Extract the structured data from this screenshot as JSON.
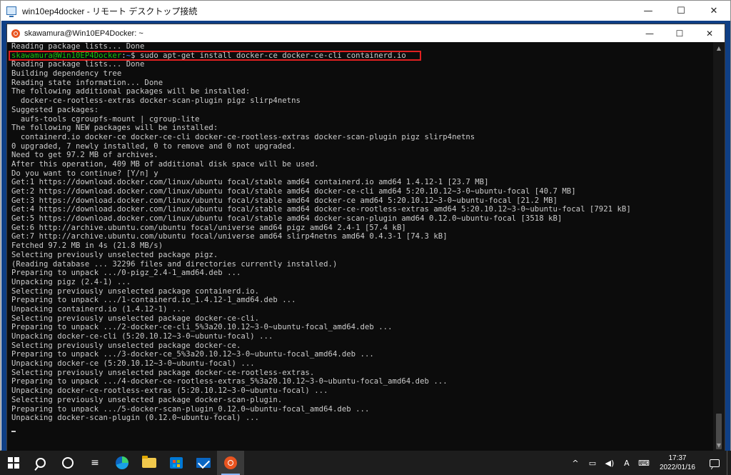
{
  "rdp": {
    "title": "win10ep4docker - リモート デスクトップ接続",
    "minimize": "—",
    "maximize": "☐",
    "close": "✕"
  },
  "terminal": {
    "title": "skawamura@Win10EP4Docker: ~",
    "minimize": "—",
    "maximize": "☐",
    "close": "✕",
    "prompt": {
      "user_host": "skawamura@Win10EP4Docker",
      "separator": ":",
      "path": "~",
      "symbol": "$",
      "command": "sudo apt-get install docker-ce docker-ce-cli containerd.io"
    },
    "lines_before": [
      "Reading package lists... Done"
    ],
    "lines_after": [
      "Reading package lists... Done",
      "Building dependency tree",
      "Reading state information... Done",
      "The following additional packages will be installed:",
      "  docker-ce-rootless-extras docker-scan-plugin pigz slirp4netns",
      "Suggested packages:",
      "  aufs-tools cgroupfs-mount | cgroup-lite",
      "The following NEW packages will be installed:",
      "  containerd.io docker-ce docker-ce-cli docker-ce-rootless-extras docker-scan-plugin pigz slirp4netns",
      "0 upgraded, 7 newly installed, 0 to remove and 0 not upgraded.",
      "Need to get 97.2 MB of archives.",
      "After this operation, 409 MB of additional disk space will be used.",
      "Do you want to continue? [Y/n] y",
      "Get:1 https://download.docker.com/linux/ubuntu focal/stable amd64 containerd.io amd64 1.4.12-1 [23.7 MB]",
      "Get:2 https://download.docker.com/linux/ubuntu focal/stable amd64 docker-ce-cli amd64 5:20.10.12~3-0~ubuntu-focal [40.7 MB]",
      "Get:3 https://download.docker.com/linux/ubuntu focal/stable amd64 docker-ce amd64 5:20.10.12~3-0~ubuntu-focal [21.2 MB]",
      "Get:4 https://download.docker.com/linux/ubuntu focal/stable amd64 docker-ce-rootless-extras amd64 5:20.10.12~3-0~ubuntu-focal [7921 kB]",
      "Get:5 https://download.docker.com/linux/ubuntu focal/stable amd64 docker-scan-plugin amd64 0.12.0~ubuntu-focal [3518 kB]",
      "Get:6 http://archive.ubuntu.com/ubuntu focal/universe amd64 pigz amd64 2.4-1 [57.4 kB]",
      "Get:7 http://archive.ubuntu.com/ubuntu focal/universe amd64 slirp4netns amd64 0.4.3-1 [74.3 kB]",
      "Fetched 97.2 MB in 4s (21.8 MB/s)",
      "Selecting previously unselected package pigz.",
      "(Reading database ... 32296 files and directories currently installed.)",
      "Preparing to unpack .../0-pigz_2.4-1_amd64.deb ...",
      "Unpacking pigz (2.4-1) ...",
      "Selecting previously unselected package containerd.io.",
      "Preparing to unpack .../1-containerd.io_1.4.12-1_amd64.deb ...",
      "Unpacking containerd.io (1.4.12-1) ...",
      "Selecting previously unselected package docker-ce-cli.",
      "Preparing to unpack .../2-docker-ce-cli_5%3a20.10.12~3-0~ubuntu-focal_amd64.deb ...",
      "Unpacking docker-ce-cli (5:20.10.12~3-0~ubuntu-focal) ...",
      "Selecting previously unselected package docker-ce.",
      "Preparing to unpack .../3-docker-ce_5%3a20.10.12~3-0~ubuntu-focal_amd64.deb ...",
      "Unpacking docker-ce (5:20.10.12~3-0~ubuntu-focal) ...",
      "Selecting previously unselected package docker-ce-rootless-extras.",
      "Preparing to unpack .../4-docker-ce-rootless-extras_5%3a20.10.12~3-0~ubuntu-focal_amd64.deb ...",
      "Unpacking docker-ce-rootless-extras (5:20.10.12~3-0~ubuntu-focal) ...",
      "Selecting previously unselected package docker-scan-plugin.",
      "Preparing to unpack .../5-docker-scan-plugin_0.12.0~ubuntu-focal_amd64.deb ...",
      "Unpacking docker-scan-plugin (0.12.0~ubuntu-focal) ..."
    ],
    "highlight_color": "#e02020"
  },
  "taskbar": {
    "items": [
      {
        "name": "start-button",
        "icon": "windows-logo-icon"
      },
      {
        "name": "search-button",
        "icon": "search-icon"
      },
      {
        "name": "task-view-button",
        "icon": "task-view-icon"
      },
      {
        "name": "widgets-button",
        "icon": "widgets-icon"
      },
      {
        "name": "edge-button",
        "icon": "edge-icon"
      },
      {
        "name": "file-explorer-button",
        "icon": "folder-icon"
      },
      {
        "name": "store-button",
        "icon": "store-icon"
      },
      {
        "name": "mail-button",
        "icon": "mail-icon"
      },
      {
        "name": "ubuntu-button",
        "icon": "ubuntu-icon",
        "active": true
      }
    ],
    "tray": {
      "chevron": "^",
      "ime": "A",
      "time": "17:37",
      "date": "2022/01/16"
    }
  },
  "colors": {
    "prompt_user": "#16c60c",
    "prompt_path": "#3b78ff",
    "terminal_bg": "#0c0c0c",
    "terminal_fg": "#cccccc",
    "desktop_bg": "#0f3f85",
    "taskbar_bg": "#1d1d1d"
  }
}
